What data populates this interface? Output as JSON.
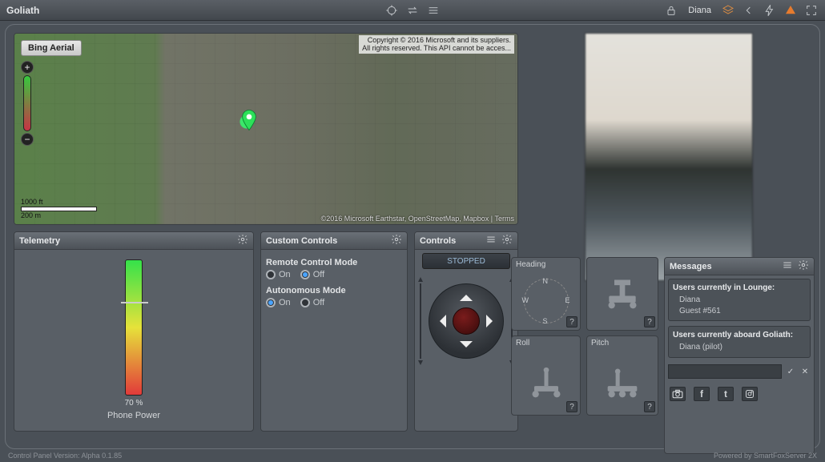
{
  "app": {
    "title": "Goliath",
    "username": "Diana"
  },
  "map": {
    "provider_label": "Bing Aerial",
    "copyright_line1": "Copyright © 2016 Microsoft and its suppliers.",
    "copyright_line2": "All rights reserved. This API cannot be acces...",
    "attribution": "©2016 Microsoft Earthstar, OpenStreetMap, Mapbox | Terms",
    "scale_ft": "1000 ft",
    "scale_m": "200 m"
  },
  "telemetry": {
    "title": "Telemetry",
    "percent_label": "70 %",
    "gauge_name": "Phone Power"
  },
  "custom": {
    "title": "Custom Controls",
    "remote_label": "Remote Control Mode",
    "autonomous_label": "Autonomous Mode",
    "on_label": "On",
    "off_label": "Off",
    "remote_selected": "Off",
    "autonomous_selected": "On"
  },
  "controls": {
    "title": "Controls",
    "status": "STOPPED"
  },
  "mini": {
    "heading_label": "Heading",
    "roll_label": "Roll",
    "pitch_label": "Pitch",
    "compass": {
      "n": "N",
      "s": "S",
      "e": "E",
      "w": "W"
    }
  },
  "messages": {
    "title": "Messages",
    "lounge_title": "Users currently in Lounge:",
    "lounge_users": [
      "Diana",
      "Guest #561"
    ],
    "aboard_title": "Users currently aboard Goliath:",
    "aboard_users": [
      "Diana (pilot)"
    ],
    "input_placeholder": ""
  },
  "footer": {
    "left": "Control Panel Version: Alpha 0.1.85",
    "right": "Powered by SmartFoxServer 2X"
  }
}
